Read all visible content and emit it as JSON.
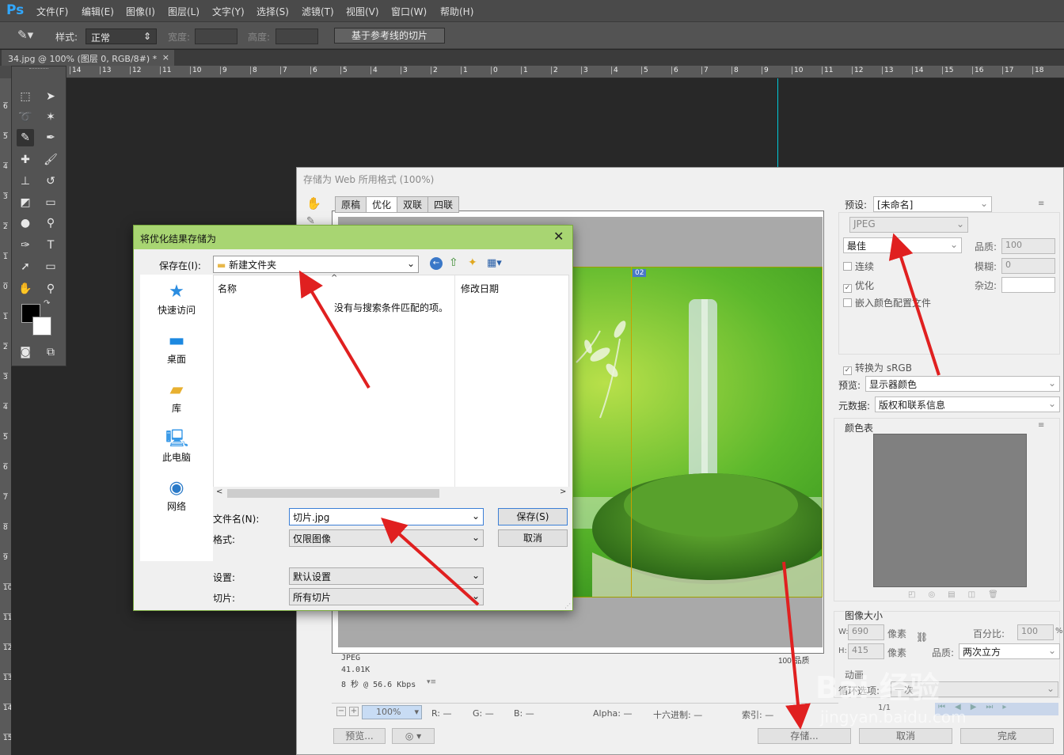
{
  "app": {
    "logo": "Ps"
  },
  "menu": [
    "文件(F)",
    "编辑(E)",
    "图像(I)",
    "图层(L)",
    "文字(Y)",
    "选择(S)",
    "滤镜(T)",
    "视图(V)",
    "窗口(W)",
    "帮助(H)"
  ],
  "options": {
    "style_label": "样式:",
    "style_value": "正常",
    "width_label": "宽度:",
    "height_label": "高度:",
    "slices_button": "基于参考线的切片"
  },
  "document_tab": {
    "title": "34.jpg @ 100% (图层 0, RGB/8#) *",
    "close": "×"
  },
  "ruler": {
    "h_ticks": [
      "14",
      "13",
      "12",
      "11",
      "10",
      "9",
      "8",
      "7",
      "6",
      "5",
      "4",
      "3",
      "2",
      "1",
      "0",
      "1",
      "2",
      "3",
      "4",
      "5",
      "6",
      "7",
      "8",
      "9",
      "10",
      "11",
      "12",
      "13",
      "14",
      "15",
      "16",
      "17",
      "18"
    ],
    "v_ticks": [
      "6",
      "5",
      "4",
      "3",
      "2",
      "1",
      "0",
      "1",
      "2",
      "3",
      "4",
      "5",
      "6",
      "7",
      "8",
      "9",
      "10",
      "11",
      "12",
      "13",
      "14",
      "15"
    ]
  },
  "sfw": {
    "title": "存储为 Web 所用格式 (100%)",
    "tabs": [
      "原稿",
      "优化",
      "双联",
      "四联"
    ],
    "slice_label": "02",
    "image_info": {
      "format": "JPEG",
      "size": "41.01K",
      "time": "8 秒 @ 56.6 Kbps",
      "quality_text": "100 品质"
    },
    "zoom": "100%",
    "status": {
      "r": "R: —",
      "g": "G: —",
      "b": "B: —",
      "alpha": "Alpha: —",
      "hex": "十六进制: —",
      "index": "索引: —"
    },
    "buttons": {
      "preview": "预览...",
      "save": "存储...",
      "cancel": "取消",
      "done": "完成"
    },
    "right": {
      "preset_label": "预设:",
      "preset_value": "[未命名]",
      "format_value": "JPEG",
      "quality_preset": "最佳",
      "quality_label": "品质:",
      "quality_value": "100",
      "blur_label": "模糊:",
      "blur_value": "0",
      "matte_label": "杂边:",
      "progressive": "连续",
      "optimized": "优化",
      "embed_profile": "嵌入颜色配置文件",
      "convert_srgb": "转换为 sRGB",
      "preview_label": "预览:",
      "preview_value": "显示器颜色",
      "metadata_label": "元数据:",
      "metadata_value": "版权和联系信息",
      "color_table_label": "颜色表",
      "image_size_label": "图像大小",
      "w_label": "W:",
      "w_value": "690",
      "h_label": "H:",
      "h_value": "415",
      "pixel_unit": "像素",
      "percent_label": "百分比:",
      "percent_value": "100",
      "percent_unit": "%",
      "resample_label": "品质:",
      "resample_value": "两次立方",
      "animation_label": "动画",
      "loop_label": "循环选项:",
      "loop_value": "一次",
      "frame_counter": "1/1"
    }
  },
  "save_dialog": {
    "title": "将优化结果存储为",
    "close": "✕",
    "save_in_label": "保存在(I):",
    "save_in_value": "新建文件夹",
    "places": [
      "快速访问",
      "桌面",
      "库",
      "此电脑",
      "网络"
    ],
    "col_name": "名称",
    "col_date": "修改日期",
    "empty_msg": "没有与搜索条件匹配的项。",
    "filename_label": "文件名(N):",
    "filename_value": "切片.jpg",
    "format_label": "格式:",
    "format_value": "仅限图像",
    "settings_label": "设置:",
    "settings_value": "默认设置",
    "slices_label": "切片:",
    "slices_value": "所有切片",
    "save_button": "保存(S)",
    "cancel_button": "取消"
  },
  "watermark": {
    "brand": "Bai 经验",
    "url": "jingyan.baidu.com"
  },
  "colors": {
    "accent_green": "#a8d572",
    "arrow_red": "#e02020",
    "ps_blue": "#31a8ff"
  }
}
